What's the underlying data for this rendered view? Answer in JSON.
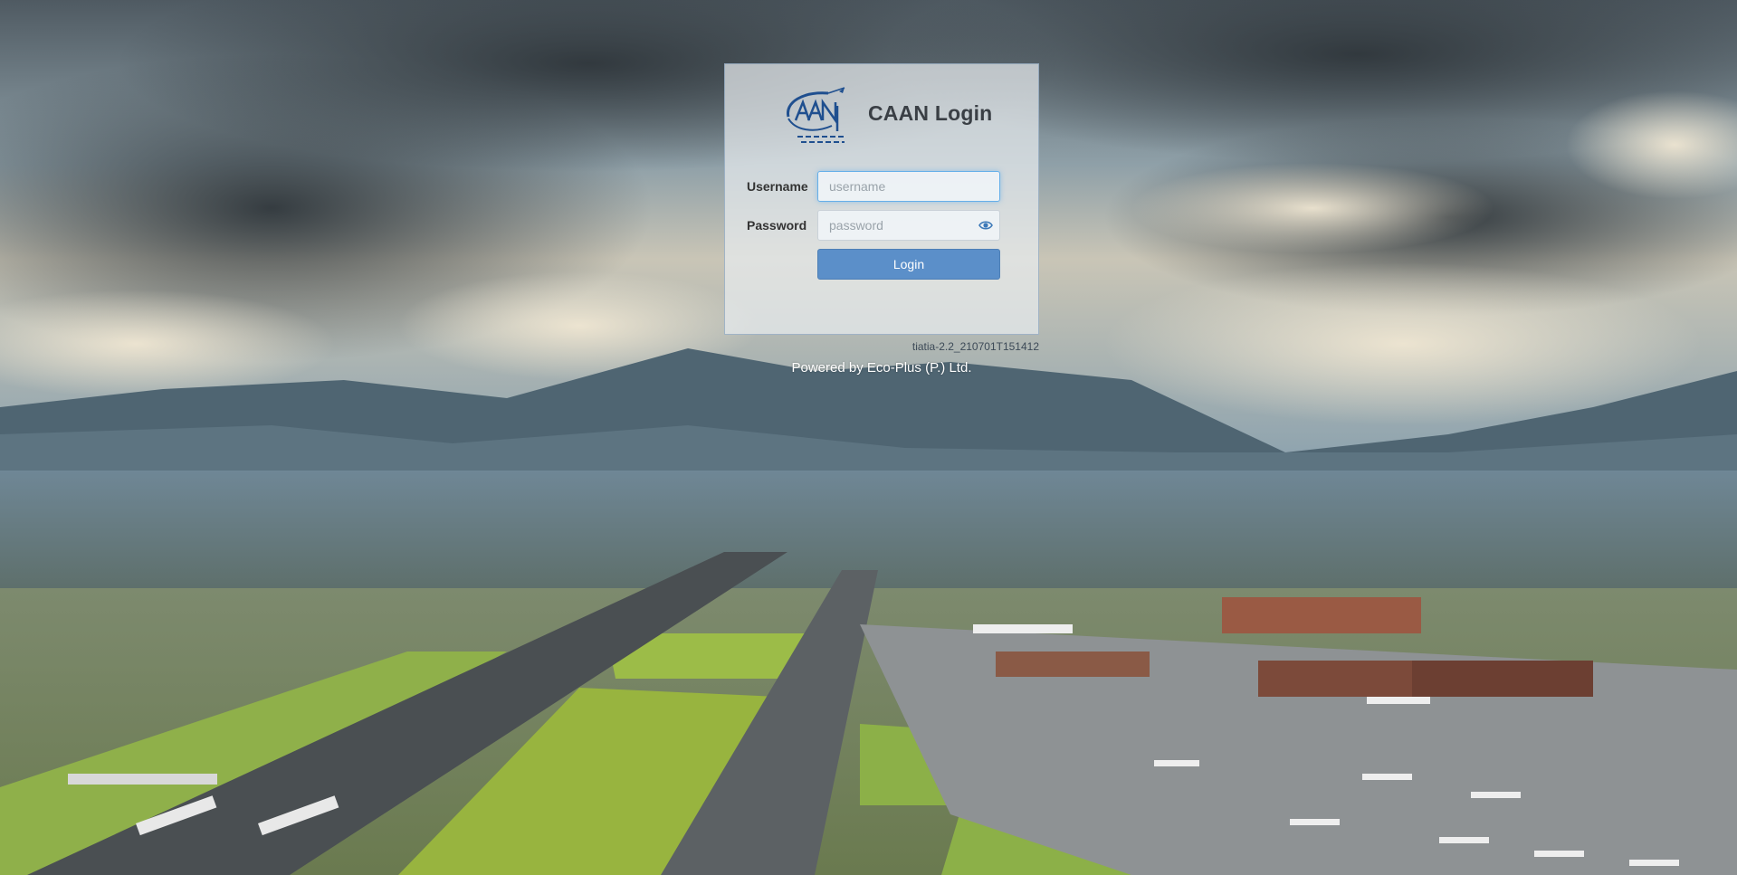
{
  "login": {
    "title": "CAAN Login",
    "logo_name": "caan-logo",
    "username_label": "Username",
    "username_placeholder": "username",
    "username_value": "",
    "password_label": "Password",
    "password_placeholder": "password",
    "password_value": "",
    "password_toggle_icon": "eye-icon",
    "submit_label": "Login"
  },
  "footer": {
    "version": "tiatia-2.2_210701T151412",
    "powered_by": "Powered by Eco-Plus (P.) Ltd."
  },
  "colors": {
    "button": "#5b8fc9",
    "logo": "#1f4f8f",
    "focus_ring": "#66afe9"
  }
}
